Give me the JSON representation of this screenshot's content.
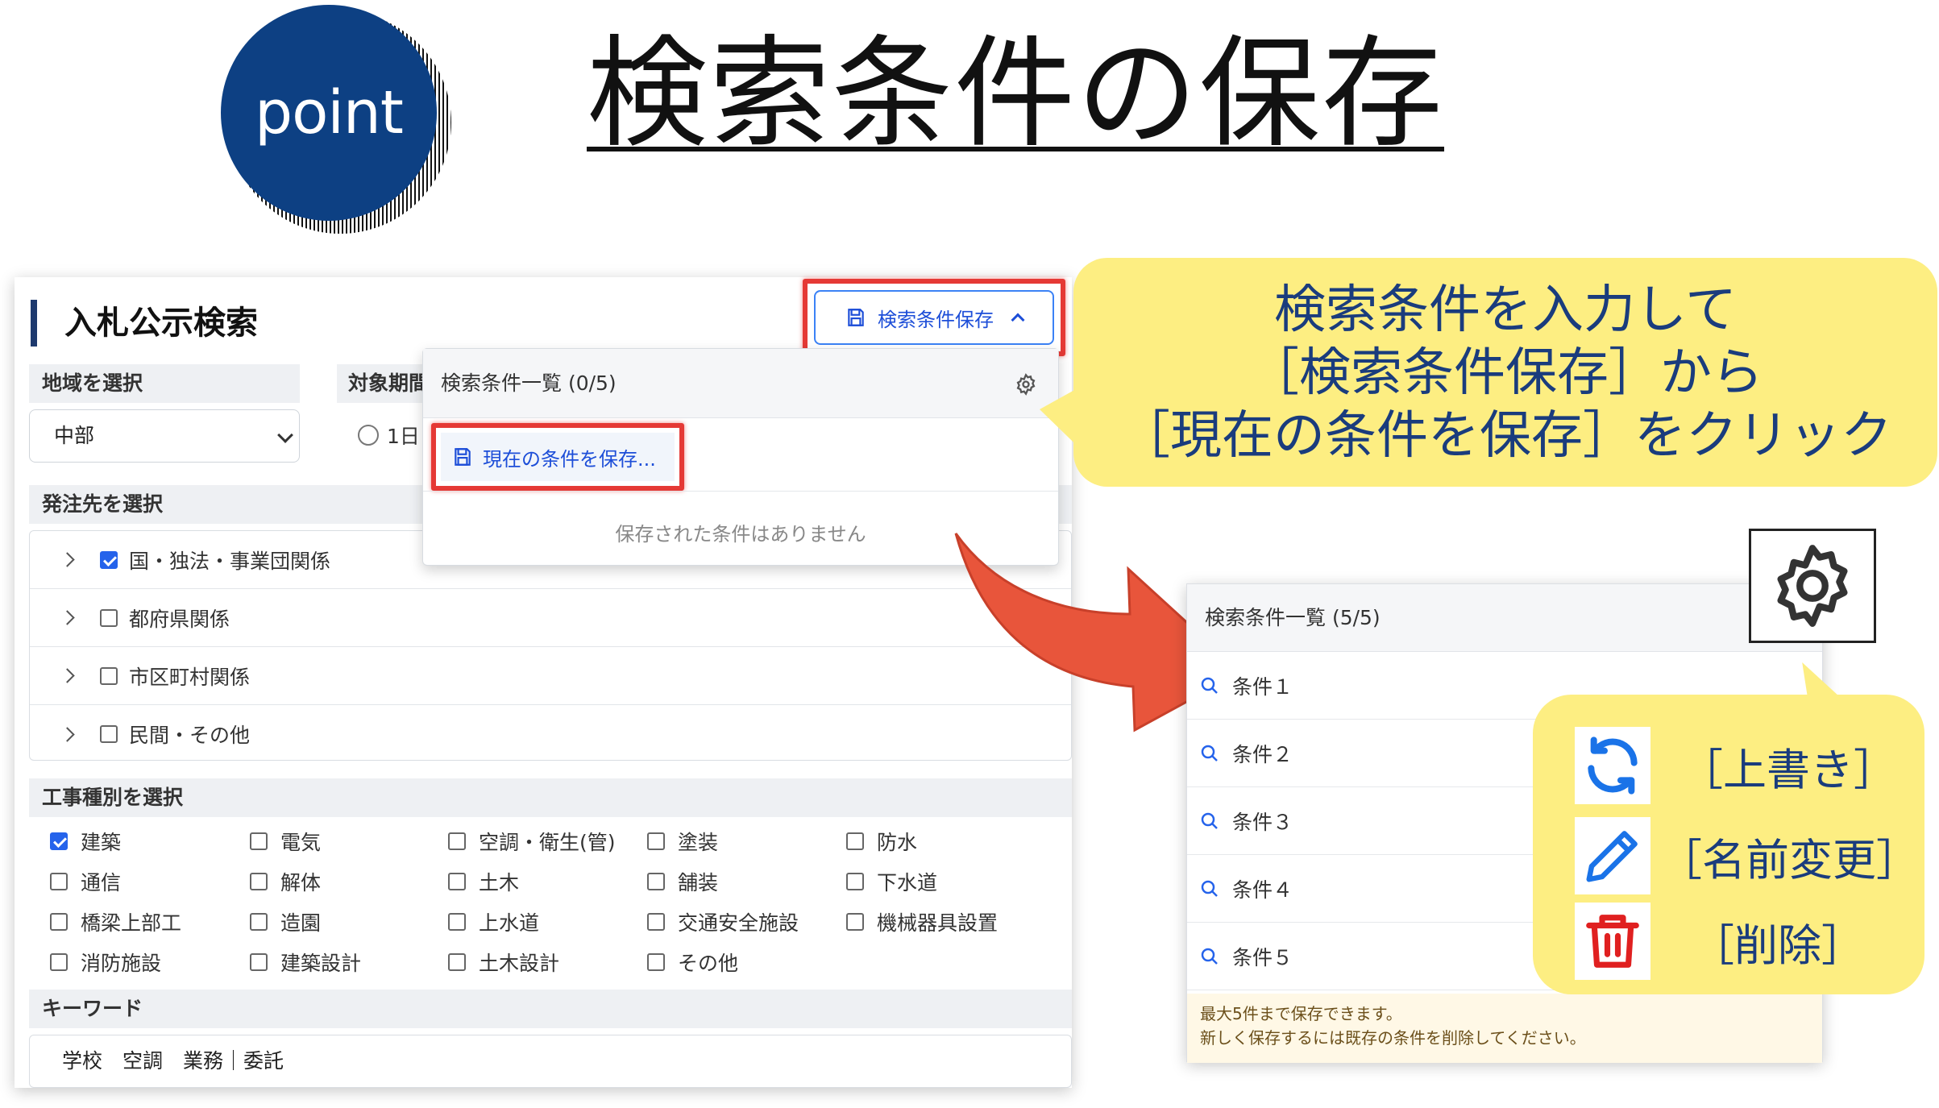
{
  "header": {
    "badge_text": "point",
    "title": "検索条件の保存"
  },
  "search_panel": {
    "title": "入札公示検索",
    "region": {
      "label": "地域を選択",
      "value": "中部"
    },
    "period": {
      "label": "対象期間",
      "option_partial": "1日"
    },
    "orderer": {
      "label": "発注先を選択",
      "items": [
        {
          "label": "国・独法・事業団関係",
          "checked": true
        },
        {
          "label": "都府県関係",
          "checked": false
        },
        {
          "label": "市区町村関係",
          "checked": false
        },
        {
          "label": "民間・その他",
          "checked": false
        }
      ]
    },
    "work_types": {
      "label": "工事種別を選択",
      "items": [
        {
          "label": "建築",
          "checked": true
        },
        {
          "label": "電気",
          "checked": false
        },
        {
          "label": "空調・衛生(管)",
          "checked": false
        },
        {
          "label": "塗装",
          "checked": false
        },
        {
          "label": "防水",
          "checked": false
        },
        {
          "label": "通信",
          "checked": false
        },
        {
          "label": "解体",
          "checked": false
        },
        {
          "label": "土木",
          "checked": false
        },
        {
          "label": "舗装",
          "checked": false
        },
        {
          "label": "下水道",
          "checked": false
        },
        {
          "label": "橋梁上部工",
          "checked": false
        },
        {
          "label": "造園",
          "checked": false
        },
        {
          "label": "上水道",
          "checked": false
        },
        {
          "label": "交通安全施設",
          "checked": false
        },
        {
          "label": "機械器具設置",
          "checked": false
        },
        {
          "label": "消防施設",
          "checked": false
        },
        {
          "label": "建築設計",
          "checked": false
        },
        {
          "label": "土木設計",
          "checked": false
        },
        {
          "label": "その他",
          "checked": false
        }
      ]
    },
    "keyword": {
      "label": "キーワード",
      "value": "学校　空調　業務｜委託"
    }
  },
  "save_button": {
    "label": "検索条件保存"
  },
  "dropdown": {
    "title": "検索条件一覧 (0/5)",
    "save_current_label": "現在の条件を保存...",
    "empty_text": "保存された条件はありません"
  },
  "callout": {
    "line1": "検索条件を入力して",
    "line2": "［検索条件保存］から",
    "line3": "［現在の条件を保存］をクリック"
  },
  "list_panel": {
    "title": "検索条件一覧 (5/5)",
    "items": [
      "条件１",
      "条件２",
      "条件３",
      "条件４",
      "条件５"
    ],
    "note_line1": "最大5件まで保存できます。",
    "note_line2": "新しく保存するには既存の条件を削除してください。"
  },
  "actions": {
    "overwrite": "［上書き］",
    "rename": "［名前変更］",
    "delete": "［削除］"
  },
  "colors": {
    "badge_blue": "#0d4083",
    "highlight_red": "#e53935",
    "callout_yellow": "#fdee82",
    "callout_text": "#1a3c7d",
    "link_blue": "#1d4ed8",
    "arrow_red": "#e8553b"
  },
  "icons": {
    "save": "floppy-disk-icon",
    "settings": "gear-icon",
    "search_item": "magnifier-icon",
    "overwrite": "refresh-icon",
    "rename": "pencil-icon",
    "delete": "trash-icon"
  }
}
